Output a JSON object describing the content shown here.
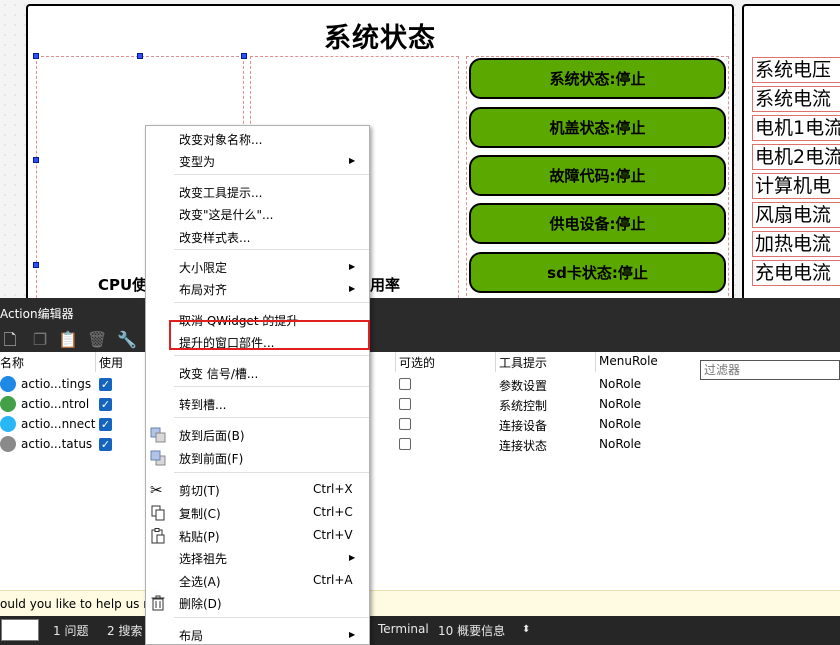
{
  "designer": {
    "title": "系统状态",
    "gauge_labels": [
      "CPU使",
      "用率"
    ],
    "status_buttons": [
      "系统状态:停止",
      "机盖状态:停止",
      "故障代码:停止",
      "供电设备:停止",
      "sd卡状态:停止"
    ],
    "metrics": [
      "系统电压",
      "系统电流",
      "电机1电流",
      "电机2电流",
      "计算机电",
      "风扇电流",
      "加热电流",
      "充电电流"
    ],
    "colors": {
      "button_green": "#5aa800",
      "selection_handle": "#3050ff"
    }
  },
  "action_editor": {
    "title": "Action编辑器",
    "filter_placeholder": "过滤器",
    "columns": {
      "name": "名称",
      "used": "使用",
      "checkable": "可选的",
      "tooltip": "工具提示",
      "menu_role": "MenuRole"
    },
    "rows": [
      {
        "icon": "gear-icon",
        "name": "actio...tings",
        "used": true,
        "checkable": false,
        "tooltip": "参数设置",
        "menu_role": "NoRole"
      },
      {
        "icon": "control-icon",
        "name": "actio...ntrol",
        "used": true,
        "checkable": false,
        "tooltip": "系统控制",
        "menu_role": "NoRole"
      },
      {
        "icon": "connect-icon",
        "name": "actio...nnect",
        "used": true,
        "checkable": false,
        "tooltip": "连接设备",
        "menu_role": "NoRole"
      },
      {
        "icon": "link-icon",
        "name": "actio...tatus",
        "used": true,
        "checkable": false,
        "tooltip": "连接状态",
        "menu_role": "NoRole"
      }
    ],
    "hint": "ould you like to help us n"
  },
  "statusbar": {
    "items": [
      "1 问题",
      "2 搜索",
      "Terminal",
      "10 概要信息"
    ]
  },
  "context_menu": {
    "change_object_name": "改变对象名称...",
    "morph_into": "变型为",
    "change_tooltip": "改变工具提示...",
    "change_whats_this": "改变\"这是什么\"...",
    "change_stylesheet": "改变样式表...",
    "size_constraints": "大小限定",
    "layout_alignment": "布局对齐",
    "unpromote": "取消 QWidget 的提升",
    "promoted_widgets": "提升的窗口部件...",
    "change_signals_slots": "改变 信号/槽...",
    "go_to_slot": "转到槽...",
    "send_to_back": "放到后面(B)",
    "bring_to_front": "放到前面(F)",
    "cut": "剪切(T)",
    "cut_shortcut": "Ctrl+X",
    "copy": "复制(C)",
    "copy_shortcut": "Ctrl+C",
    "paste": "粘贴(P)",
    "paste_shortcut": "Ctrl+V",
    "select_ancestor": "选择祖先",
    "select_all": "全选(A)",
    "select_all_shortcut": "Ctrl+A",
    "delete": "删除(D)",
    "layout": "布局",
    "highlight_color": "#e02020"
  }
}
